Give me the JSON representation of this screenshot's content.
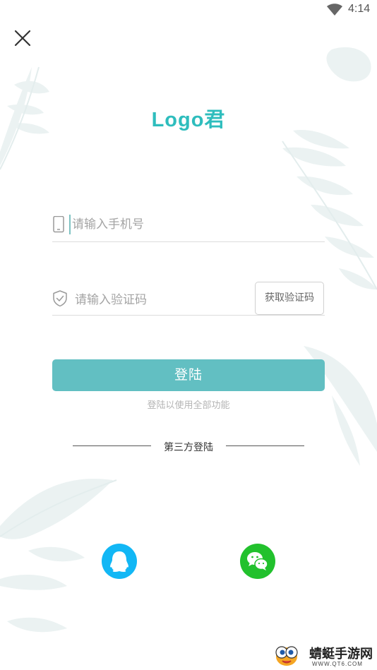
{
  "status_bar": {
    "time": "4:14",
    "wifi_icon": "wifi-icon"
  },
  "header": {
    "close_icon": "close-icon"
  },
  "logo": {
    "text": "Logo君",
    "color": "#2ebdbd"
  },
  "form": {
    "phone_placeholder": "请输入手机号",
    "phone_value": "",
    "phone_icon": "phone-icon",
    "code_placeholder": "请输入验证码",
    "code_value": "",
    "code_icon": "shield-check-icon",
    "get_code_label": "获取验证码"
  },
  "login": {
    "button_label": "登陆",
    "hint": "登陆以使用全部功能",
    "button_color": "#62bfc2"
  },
  "third_party": {
    "title": "第三方登陆",
    "providers": [
      {
        "name": "qq",
        "icon": "qq-icon",
        "color": "#12b7f5"
      },
      {
        "name": "wechat",
        "icon": "wechat-icon",
        "color": "#22c12d"
      }
    ]
  },
  "watermark": {
    "name": "蜻蜓手游网",
    "url": "WWW.QT6.COM"
  }
}
